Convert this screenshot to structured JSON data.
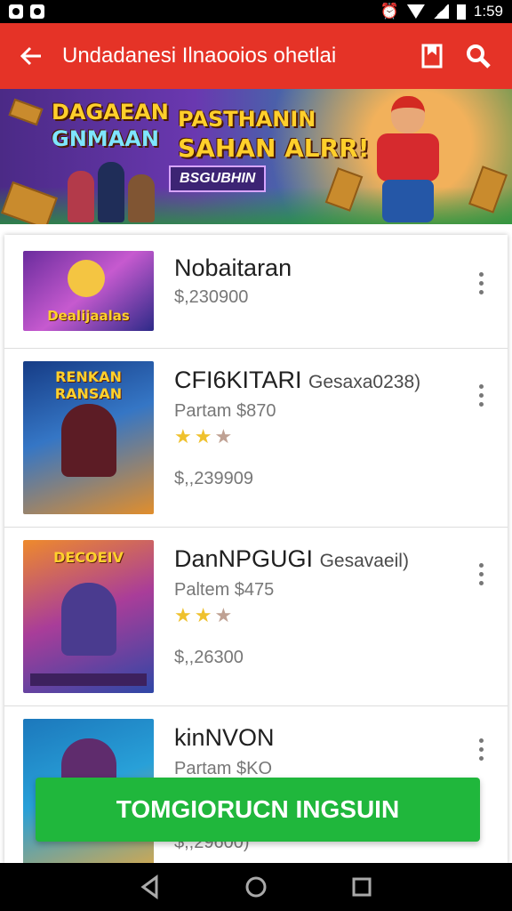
{
  "status": {
    "time": "1:59"
  },
  "app_bar": {
    "title": "Undadanesi  Ilnaooios ohetlai",
    "back_icon": "arrow-left-icon",
    "bookmark_icon": "bookmark-icon",
    "search_icon": "search-icon",
    "color": "#e53327"
  },
  "banner": {
    "line1": "DAGAEAN",
    "line2": "GNMAAN",
    "line3": "PASTHANIN",
    "line4": "SAHAN ALRR!",
    "tag": "BSGUBHIN"
  },
  "items": [
    {
      "title": "Nobaitaran",
      "price": "$,230900",
      "thumb_top": "",
      "thumb_bottom": "Dealijaalas",
      "rating": 0
    },
    {
      "title": "CFI6KITARI",
      "title_note": "Gesaxa0238)",
      "meta": "Partam $870",
      "price": "$,,239909",
      "thumb_top": "RENKAN RANSAN",
      "rating": 2
    },
    {
      "title": "DanNPGUGI",
      "title_note": "Gesavaeil)",
      "meta": "Paltem $475",
      "price": "$,,26300",
      "thumb_top": "DECOEIV",
      "rating": 2
    },
    {
      "title": "kinNVON",
      "meta": "Partam $KO",
      "price": "$,,29600)",
      "thumb_top": "",
      "rating": 0
    }
  ],
  "cta": {
    "label": "TOMGIORUCN INGSUIN",
    "color": "#20b73c"
  },
  "nav": {
    "back_icon": "triangle-back-icon",
    "home_icon": "circle-home-icon",
    "recent_icon": "square-recent-icon"
  }
}
